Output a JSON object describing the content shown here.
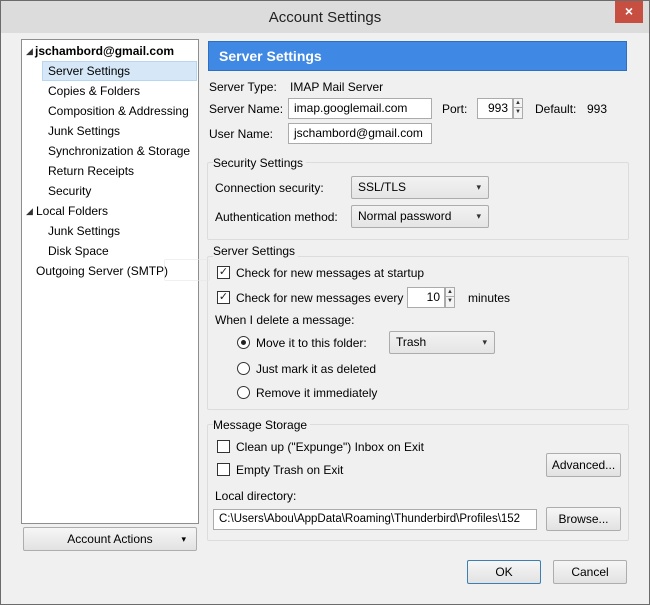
{
  "window": {
    "title": "Account Settings",
    "close_glyph": "×"
  },
  "tree": {
    "items": [
      {
        "label": "jschambord@gmail.com",
        "expanded": true
      },
      {
        "label": "Server Settings"
      },
      {
        "label": "Copies & Folders"
      },
      {
        "label": "Composition & Addressing"
      },
      {
        "label": "Junk Settings"
      },
      {
        "label": "Synchronization & Storage"
      },
      {
        "label": "Return Receipts"
      },
      {
        "label": "Security"
      },
      {
        "label": "Local Folders",
        "expanded": true
      },
      {
        "label": "Junk Settings"
      },
      {
        "label": "Disk Space"
      },
      {
        "label": "Outgoing Server (SMTP)"
      }
    ],
    "selected": "Server Settings"
  },
  "account_actions": {
    "label": "Account Actions",
    "caret": "▾"
  },
  "header": {
    "title": "Server Settings"
  },
  "server": {
    "type_label": "Server Type:",
    "type_value": "IMAP Mail Server",
    "name_label": "Server Name:",
    "name_value": "imap.googlemail.com",
    "port_label": "Port:",
    "port_value": "993",
    "default_label": "Default:",
    "default_value": "993",
    "user_label": "User Name:",
    "user_value": "jschambord@gmail.com"
  },
  "security": {
    "group_title": "Security Settings",
    "connection_label": "Connection security:",
    "connection_value": "SSL/TLS",
    "auth_label": "Authentication method:",
    "auth_value": "Normal password"
  },
  "server_settings": {
    "group_title": "Server Settings",
    "check_startup_label": "Check for new messages at startup",
    "check_startup": true,
    "check_every_label": "Check for new messages every",
    "check_every": true,
    "interval_value": "10",
    "minutes_label": "minutes",
    "delete_label": "When I delete a message:",
    "move_label": "Move it to this folder:",
    "folder_value": "Trash",
    "mark_label": "Just mark it as deleted",
    "remove_label": "Remove it immediately",
    "delete_choice": "move"
  },
  "storage": {
    "group_title": "Message Storage",
    "cleanup_label": "Clean up (\"Expunge\") Inbox on Exit",
    "cleanup": false,
    "empty_trash_label": "Empty Trash on Exit",
    "empty_trash": false,
    "advanced_label": "Advanced...",
    "local_dir_label": "Local directory:",
    "local_dir_value": "C:\\Users\\Abou\\AppData\\Roaming\\Thunderbird\\Profiles\\152",
    "browse_label": "Browse..."
  },
  "footer": {
    "ok_label": "OK",
    "cancel_label": "Cancel"
  },
  "icons": {
    "check": "✓",
    "spin_up": "▲",
    "spin_down": "▼",
    "caret": "▾",
    "tree_expanded": "◢"
  },
  "colors": {
    "header_bg": "#3f88e3",
    "selection_bg": "#d6e8f8",
    "close_bg": "#c74f42"
  }
}
